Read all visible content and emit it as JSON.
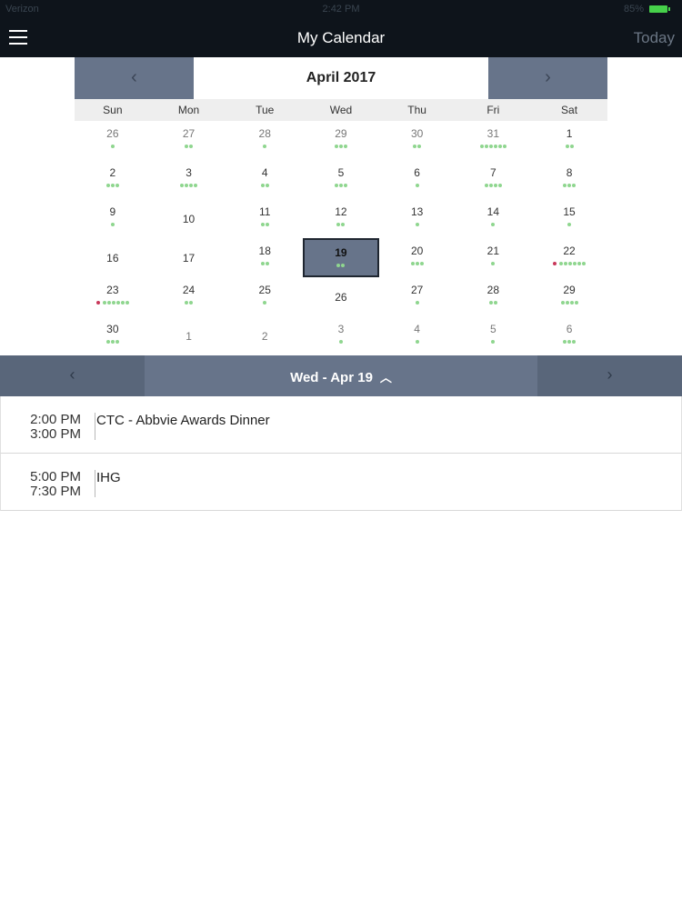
{
  "status_bar": {
    "time": "2:42 PM",
    "carrier": "Verizon",
    "battery_label": "85%"
  },
  "nav": {
    "title": "My Calendar",
    "today_label": "Today"
  },
  "calendar": {
    "month_title": "April 2017",
    "weekdays": [
      "Sun",
      "Mon",
      "Tue",
      "Wed",
      "Thu",
      "Fri",
      "Sat"
    ],
    "weeks": [
      [
        {
          "day": "26",
          "dots": 1,
          "muted": true
        },
        {
          "day": "27",
          "dots": 2,
          "muted": true
        },
        {
          "day": "28",
          "dots": 1,
          "muted": true
        },
        {
          "day": "29",
          "dots": 3,
          "muted": true
        },
        {
          "day": "30",
          "dots": 2,
          "muted": true
        },
        {
          "day": "31",
          "dots": 6,
          "muted": true
        },
        {
          "day": "1",
          "dots": 2
        }
      ],
      [
        {
          "day": "2",
          "dots": 3
        },
        {
          "day": "3",
          "dots": 4
        },
        {
          "day": "4",
          "dots": 2
        },
        {
          "day": "5",
          "dots": 3
        },
        {
          "day": "6",
          "dots": 1
        },
        {
          "day": "7",
          "dots": 4
        },
        {
          "day": "8",
          "dots": 3
        }
      ],
      [
        {
          "day": "9",
          "dots": 1
        },
        {
          "day": "10",
          "dots": 0
        },
        {
          "day": "11",
          "dots": 2
        },
        {
          "day": "12",
          "dots": 2
        },
        {
          "day": "13",
          "dots": 1
        },
        {
          "day": "14",
          "dots": 1
        },
        {
          "day": "15",
          "dots": 1
        }
      ],
      [
        {
          "day": "16",
          "dots": 0
        },
        {
          "day": "17",
          "dots": 0
        },
        {
          "day": "18",
          "dots": 2
        },
        {
          "day": "19",
          "dots": 2,
          "selected": true
        },
        {
          "day": "20",
          "dots": 3
        },
        {
          "day": "21",
          "dots": 1
        },
        {
          "day": "22",
          "dots": 6,
          "red": 1
        }
      ],
      [
        {
          "day": "23",
          "dots": 6,
          "red": 1
        },
        {
          "day": "24",
          "dots": 2
        },
        {
          "day": "25",
          "dots": 1
        },
        {
          "day": "26",
          "dots": 0
        },
        {
          "day": "27",
          "dots": 1
        },
        {
          "day": "28",
          "dots": 2
        },
        {
          "day": "29",
          "dots": 4
        }
      ],
      [
        {
          "day": "30",
          "dots": 3
        },
        {
          "day": "1",
          "dots": 0,
          "muted": true
        },
        {
          "day": "2",
          "dots": 0,
          "muted": true
        },
        {
          "day": "3",
          "dots": 1,
          "muted": true
        },
        {
          "day": "4",
          "dots": 1,
          "muted": true
        },
        {
          "day": "5",
          "dots": 1,
          "muted": true
        },
        {
          "day": "6",
          "dots": 3,
          "muted": true
        }
      ]
    ]
  },
  "day_bar": {
    "title": "Wed - Apr 19"
  },
  "events": [
    {
      "start": "2:00 PM",
      "end": "3:00 PM",
      "title": "CTC - Abbvie Awards Dinner"
    },
    {
      "start": "5:00 PM",
      "end": "7:30 PM",
      "title": "IHG"
    }
  ],
  "colors": {
    "nav_bg": "#0e141b",
    "accent": "#67748a",
    "event_dot": "#8fd68f",
    "alert_dot": "#c8385a",
    "battery": "#46d14a"
  }
}
